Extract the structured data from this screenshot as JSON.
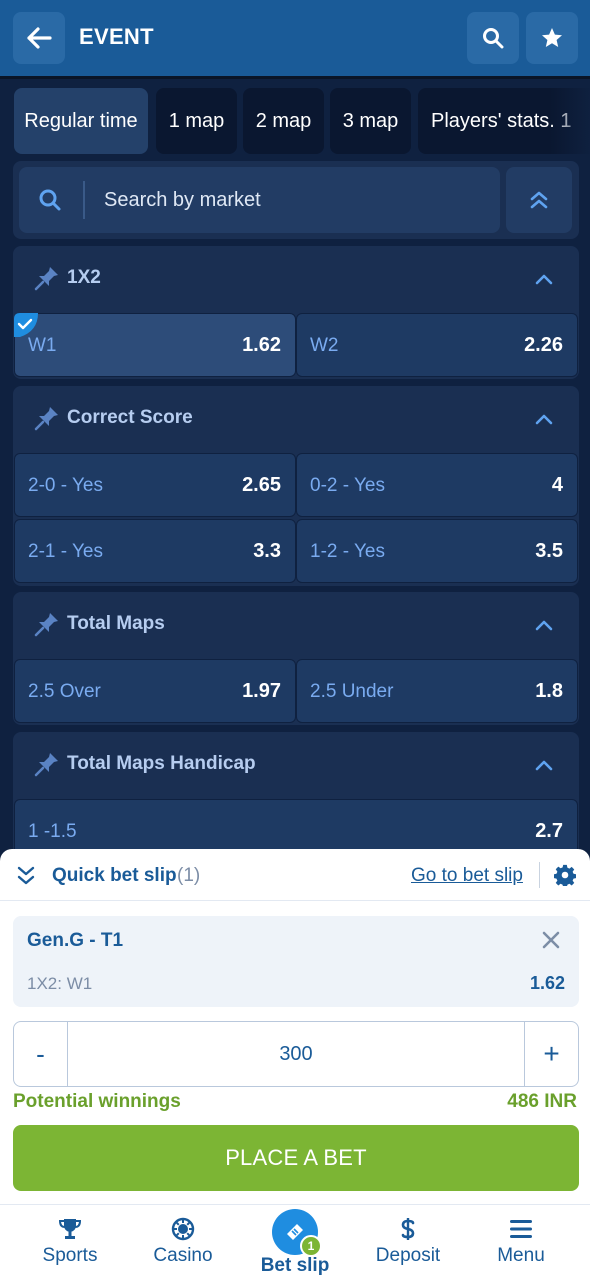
{
  "header": {
    "title": "EVENT"
  },
  "tabs": [
    {
      "label": "Regular time"
    },
    {
      "label": "1 map"
    },
    {
      "label": "2 map"
    },
    {
      "label": "3 map"
    },
    {
      "label": "Players' stats. 1"
    }
  ],
  "search": {
    "placeholder": "Search by market"
  },
  "markets": [
    {
      "title": "1X2",
      "odds": [
        {
          "label": "W1",
          "value": "1.62",
          "selected": true
        },
        {
          "label": "W2",
          "value": "2.26"
        }
      ]
    },
    {
      "title": "Correct Score",
      "odds": [
        {
          "label": "2-0 - Yes",
          "value": "2.65"
        },
        {
          "label": "0-2 - Yes",
          "value": "4"
        },
        {
          "label": "2-1 - Yes",
          "value": "3.3"
        },
        {
          "label": "1-2 - Yes",
          "value": "3.5"
        }
      ]
    },
    {
      "title": "Total Maps",
      "odds": [
        {
          "label": "2.5 Over",
          "value": "1.97"
        },
        {
          "label": "2.5 Under",
          "value": "1.8"
        }
      ]
    },
    {
      "title": "Total Maps Handicap",
      "odds": [
        {
          "label": "1 -1.5",
          "value": "2.7"
        }
      ]
    }
  ],
  "bet_slip": {
    "title": "Quick bet slip",
    "count": "(1)",
    "goto_label": "Go to bet slip",
    "event": "Gen.G - T1",
    "market": "1X2: W1",
    "odd": "1.62",
    "minus": "-",
    "plus": "+",
    "stake": "300",
    "winnings_label": "Potential winnings",
    "winnings_value": "486 INR",
    "place_label": "PLACE A BET"
  },
  "nav": {
    "items": [
      {
        "label": "Sports",
        "icon": "trophy-icon"
      },
      {
        "label": "Casino",
        "icon": "chip-icon"
      },
      {
        "label": "Bet slip",
        "icon": "ticket-icon",
        "badge": "1"
      },
      {
        "label": "Deposit",
        "icon": "dollar-icon"
      },
      {
        "label": "Menu",
        "icon": "menu-icon"
      }
    ]
  },
  "colors": {
    "header": "#1a5b98",
    "background": "#0f2140",
    "accent_green": "#7cb534",
    "link_blue": "#7aabf0"
  }
}
